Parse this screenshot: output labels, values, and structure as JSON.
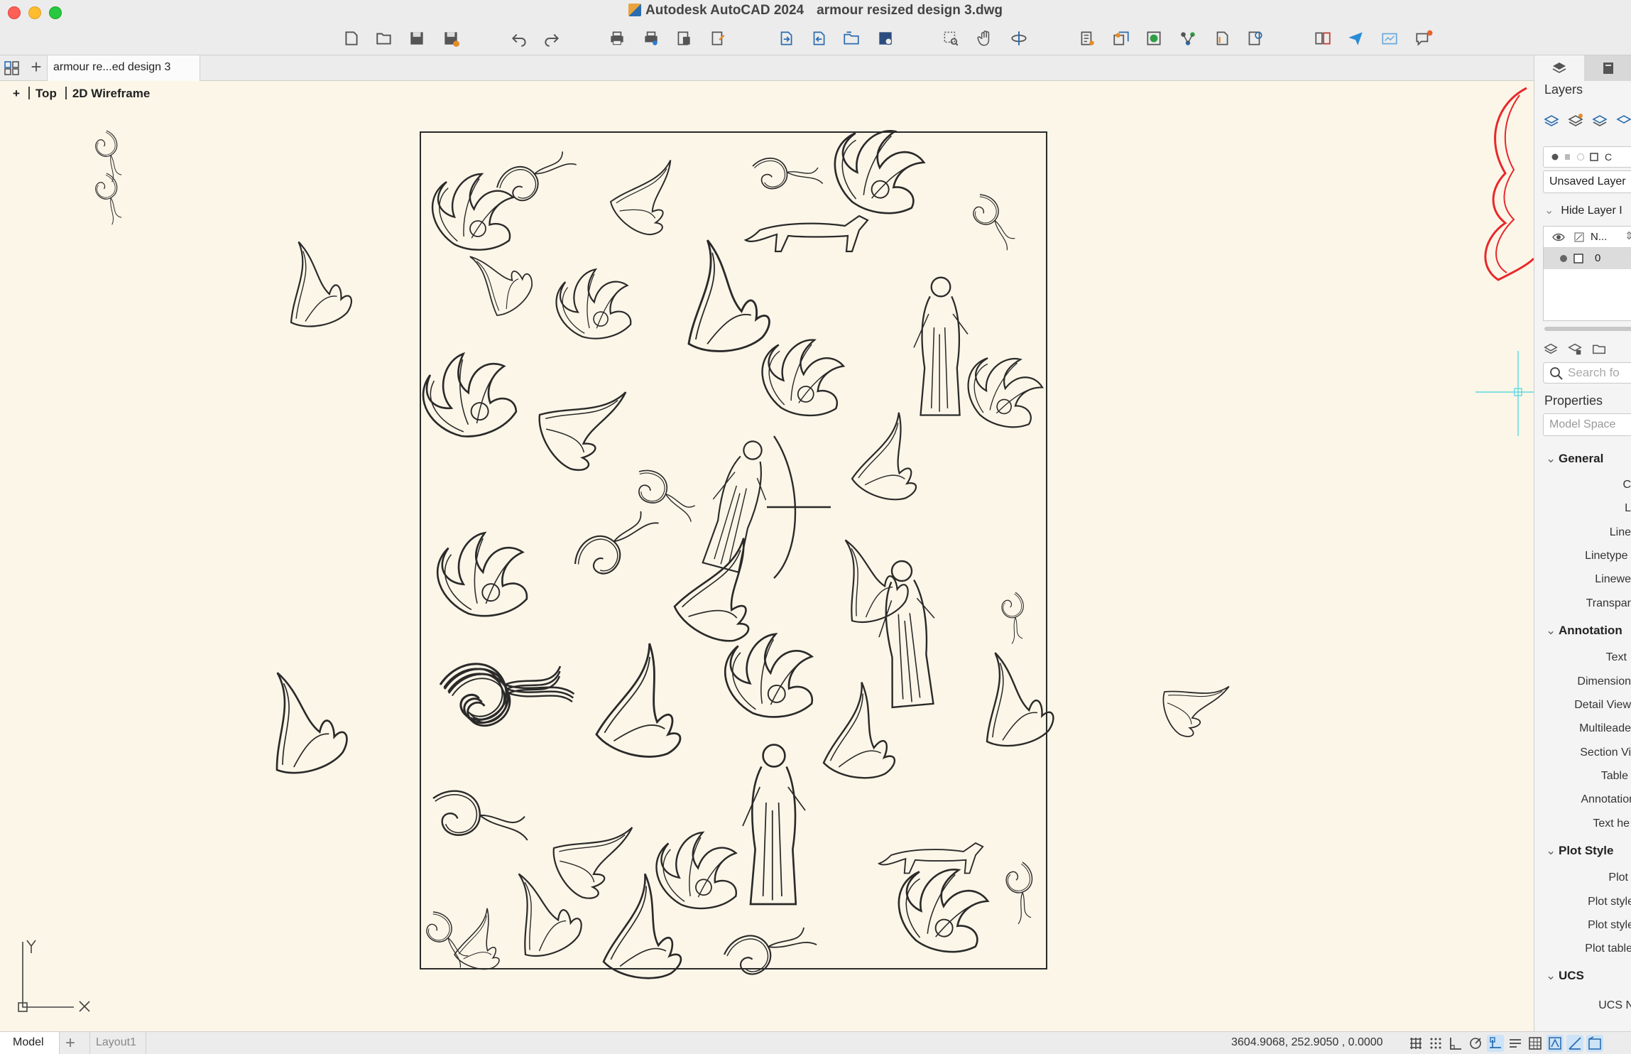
{
  "window": {
    "app_title": "Autodesk AutoCAD 2024",
    "doc_title": "armour resized design 3.dwg"
  },
  "toolbar": {
    "icons": [
      "new-icon",
      "open-icon",
      "save-icon",
      "save-as-icon",
      "undo-icon",
      "redo-icon",
      "plot-icon",
      "batch-plot-icon",
      "plot-preview-icon",
      "publish-icon",
      "import-icon",
      "export-icon",
      "etransmit-icon",
      "save-to-web-icon",
      "zoom-icon",
      "pan-icon",
      "orbit-icon",
      "properties-match-icon",
      "block-editor-icon",
      "insert-icon",
      "xref-icon",
      "sheet-set-icon",
      "quick-calc-icon",
      "compare-icon",
      "share-icon",
      "render-icon",
      "messages-icon"
    ]
  },
  "tabs": {
    "doc_tab": "armour re...ed design 3",
    "add": "+"
  },
  "viewport": {
    "plus": "+",
    "view": "Top",
    "style": "2D Wireframe"
  },
  "ucs": {
    "x": "X",
    "y": "Y"
  },
  "palette": {
    "layers_title": "Layers",
    "layer_state": "Unsaved Layer",
    "hide_layer": "Hide Layer I",
    "layer_col_name": "N...",
    "layer_0": "0",
    "search_placeholder": "Search fo",
    "properties_title": "Properties",
    "space": "Model Space",
    "sections": {
      "general": "General",
      "annotation": "Annotation",
      "plot_style": "Plot Style",
      "ucs": "UCS"
    },
    "general_rows": [
      "C",
      "L",
      "Line",
      "Linetype s",
      "Linewe",
      "Transpar"
    ],
    "annotation_rows": [
      "Text",
      "Dimension",
      "Detail View",
      "Multileade",
      "Section Vi",
      "Table",
      "Annotation",
      "Text he"
    ],
    "plot_rows": [
      "Plot",
      "Plot style",
      "Plot style",
      "Plot table"
    ],
    "ucs_rows": [
      "UCS N"
    ]
  },
  "status": {
    "model_tab": "Model",
    "add_layout": "+",
    "layout1_tab": "Layout1",
    "coordinates": "3604.9068, 252.9050 , 0.0000"
  },
  "colors": {
    "canvas_bg": "#fcf6e8",
    "line": "#2a2a2a",
    "selection_red": "#e8282c",
    "crosshair_cyan": "#5fd8e0"
  }
}
